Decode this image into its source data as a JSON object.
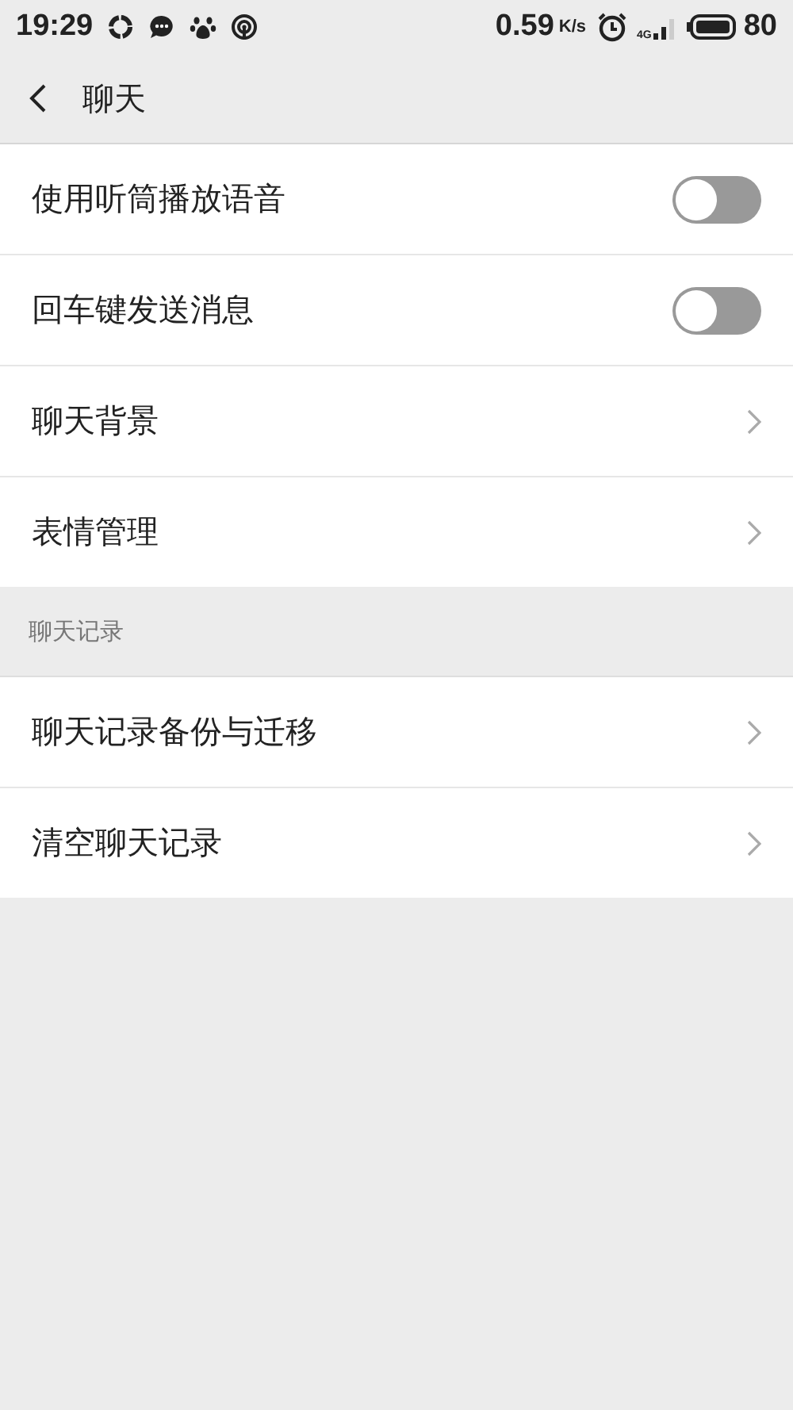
{
  "status_bar": {
    "time": "19:29",
    "speed": "0.59",
    "speed_unit": "K/s",
    "network": "4G",
    "battery": "80"
  },
  "header": {
    "title": "聊天"
  },
  "groups": [
    {
      "items": [
        {
          "kind": "toggle",
          "label": "使用听筒播放语音",
          "on": false
        },
        {
          "kind": "toggle",
          "label": "回车键发送消息",
          "on": false
        },
        {
          "kind": "link",
          "label": "聊天背景"
        },
        {
          "kind": "link",
          "label": "表情管理"
        }
      ]
    },
    {
      "title": "聊天记录",
      "items": [
        {
          "kind": "link",
          "label": "聊天记录备份与迁移"
        },
        {
          "kind": "link",
          "label": "清空聊天记录"
        }
      ]
    }
  ]
}
